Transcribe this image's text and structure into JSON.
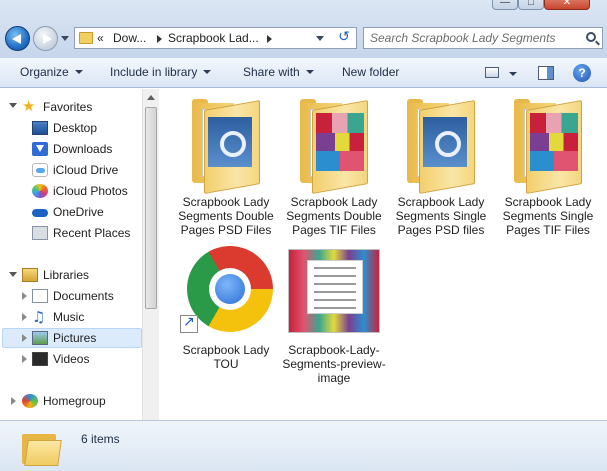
{
  "address": {
    "prefix": "«",
    "segments": [
      "Dow...",
      "Scrapbook Lad..."
    ]
  },
  "search": {
    "placeholder": "Search Scrapbook Lady Segments"
  },
  "toolbar": {
    "organize": "Organize",
    "include_in_library": "Include in library",
    "share_with": "Share with",
    "new_folder": "New folder",
    "help": "?"
  },
  "nav": {
    "favorites": "Favorites",
    "desktop": "Desktop",
    "downloads": "Downloads",
    "icloud_drive": "iCloud Drive",
    "icloud_photos": "iCloud Photos",
    "onedrive": "OneDrive",
    "recent_places": "Recent Places",
    "libraries": "Libraries",
    "documents": "Documents",
    "music": "Music",
    "pictures": "Pictures",
    "videos": "Videos",
    "homegroup": "Homegroup"
  },
  "files": [
    {
      "name": "Scrapbook Lady Segments Double Pages PSD Files",
      "kind": "folder-psd"
    },
    {
      "name": "Scrapbook Lady Segments Double Pages TIF Files",
      "kind": "folder-tif"
    },
    {
      "name": "Scrapbook Lady Segments Single Pages PSD files",
      "kind": "folder-psd"
    },
    {
      "name": "Scrapbook Lady Segments Single Pages TIF Files",
      "kind": "folder-tif"
    },
    {
      "name": "Scrapbook Lady TOU",
      "kind": "chrome-shortcut"
    },
    {
      "name": "Scrapbook-Lady-Segments-preview-image",
      "kind": "image"
    }
  ],
  "details": {
    "count": "6 items"
  },
  "colors": {
    "accent": "#1d56b5",
    "selection": "#dcebfc",
    "folder": "#f2cf6d"
  }
}
